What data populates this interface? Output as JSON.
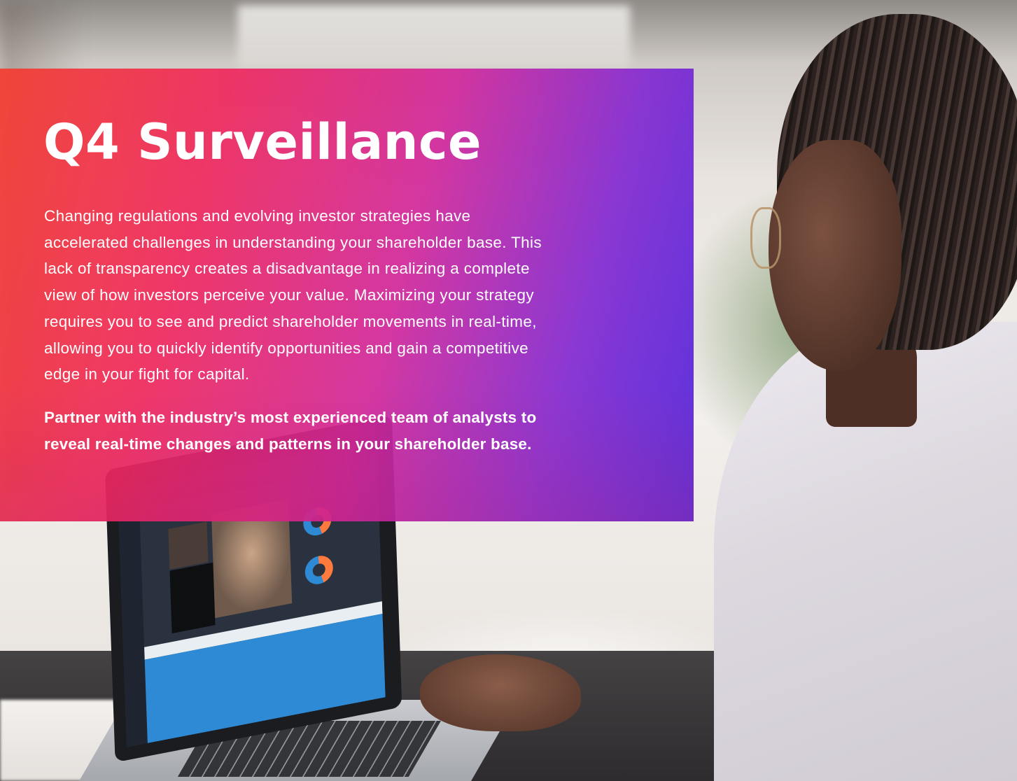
{
  "hero": {
    "title": "Q4 Surveillance",
    "body_lines": [
      "Changing regulations and evolving investor strategies have",
      "accelerated challenges in understanding your shareholder base. This",
      "lack of transparency creates a disadvantage in realizing a complete",
      "view of how investors perceive your value. Maximizing your strategy",
      "requires you to see and predict shareholder movements in real-time,",
      "allowing you to quickly identify opportunities and gain a competitive",
      "edge in your fight for capital."
    ],
    "cta_lines": [
      "Partner with the industry’s most experienced team of analysts to",
      "reveal real-time changes and patterns in your shareholder base."
    ]
  },
  "colors": {
    "gradient_start": "#f24032",
    "gradient_mid": "#d2289b",
    "gradient_end": "#5228dc",
    "text": "#ffffff",
    "laptop_ui_accent": "#2f8ad6"
  }
}
